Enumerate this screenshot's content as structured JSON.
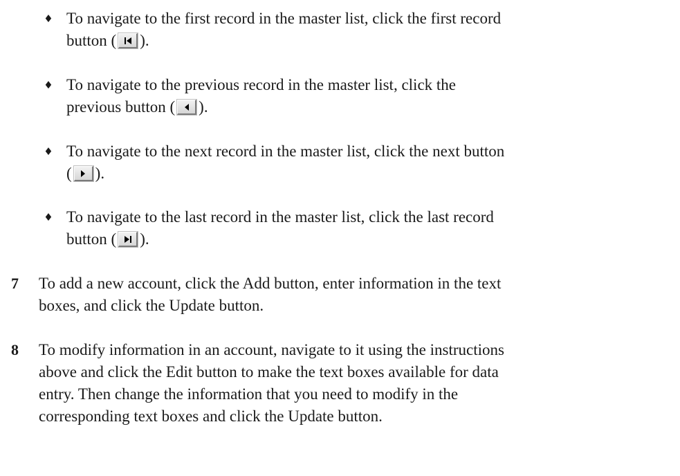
{
  "bullets": [
    {
      "glyph": "♦",
      "line1": "To navigate to the first record in the master list, click the first record",
      "line2_before": "button (",
      "line2_after": ").",
      "icon": "first-record-icon"
    },
    {
      "glyph": "♦",
      "line1": "To navigate to the previous record in the master list, click the",
      "line2_before": "previous button (",
      "line2_after": ").",
      "icon": "previous-record-icon"
    },
    {
      "glyph": "♦",
      "line1": "To navigate to the next record in the master list, click the next button",
      "line2_before": "(",
      "line2_after": ").",
      "icon": "next-record-icon"
    },
    {
      "glyph": "♦",
      "line1": "To navigate to the last record in the master list, click the last record",
      "line2_before": "button (",
      "line2_after": ").",
      "icon": "last-record-icon"
    }
  ],
  "steps": [
    {
      "number": "7",
      "lines": [
        "To add a new account, click the Add button, enter information in the text",
        "boxes, and click the Update button."
      ]
    },
    {
      "number": "8",
      "lines": [
        "To modify information in an account, navigate to it using the instructions",
        "above and click the Edit button to make the text boxes available for data",
        "entry. Then change the information that you need to modify in the",
        "corresponding text boxes and click the Update button."
      ]
    }
  ],
  "colors": {
    "text": "#1a1a1a",
    "button_face": "#e0e0e0",
    "button_shadow": "#7a7a7a",
    "arrow": "#000000"
  }
}
